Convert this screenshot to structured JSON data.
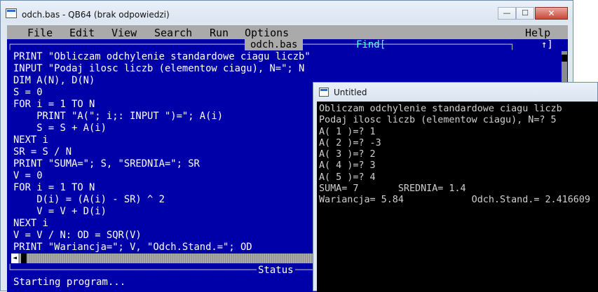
{
  "qb_window": {
    "title": "odch.bas - QB64 (brak odpowiedzi)",
    "min_glyph": "—",
    "max_glyph": "☐",
    "close_glyph": "✕"
  },
  "menu": {
    "file": "File",
    "edit": "Edit",
    "view": "View",
    "search": "Search",
    "run": "Run",
    "options": "Options",
    "help": "Help"
  },
  "editor": {
    "filename": "odch.bas",
    "find_label": "Find[",
    "find_end": "↑]",
    "lines": [
      "PRINT \"Obliczam odchylenie standardowe ciagu liczb\"",
      "INPUT \"Podaj ilosc liczb (elementow ciagu), N=\"; N",
      "DIM A(N), D(N)",
      "S = 0",
      "FOR i = 1 TO N",
      "    PRINT \"A(\"; i;: INPUT \")=\"; A(i)",
      "    S = S + A(i)",
      "NEXT i",
      "SR = S / N",
      "PRINT \"SUMA=\"; S, \"SREDNIA=\"; SR",
      "V = 0",
      "FOR i = 1 TO N",
      "    D(i) = (A(i) - SR) ^ 2",
      "    V = V + D(i)",
      "NEXT i",
      "V = V / N: OD = SQR(V)",
      "PRINT \"Wariancja=\"; V, \"Odch.Stand.=\"; OD"
    ]
  },
  "status": {
    "label": "Status",
    "text": "Starting program..."
  },
  "untitled_window": {
    "title": "Untitled",
    "output": [
      "Obliczam odchylenie standardowe ciagu liczb",
      "Podaj ilosc liczb (elementow ciagu), N=? 5",
      "A( 1 )=? 1",
      "A( 2 )=? -3",
      "A( 3 )=? 2",
      "A( 4 )=? 3",
      "A( 5 )=? 4",
      "SUMA= 7       SREDNIA= 1.4",
      "Wariancja= 5.84            Odch.Stand.= 2.416609"
    ]
  },
  "colors": {
    "qb_blue": "#0000a8",
    "menu_grey": "#aaaaaa",
    "find_cyan": "#55ffff"
  }
}
